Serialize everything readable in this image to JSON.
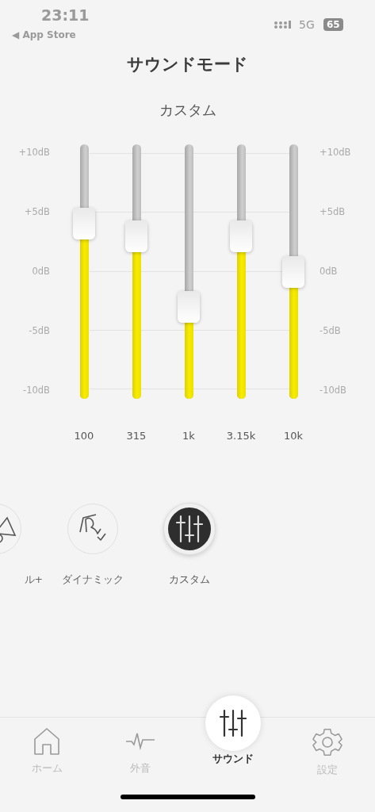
{
  "status_bar": {
    "time": "23:11",
    "back": "◀ App Store",
    "network": "5G",
    "battery": "65"
  },
  "title": "サウンドモード",
  "subtitle": "カスタム",
  "equalizer": {
    "scale_left": [
      "+10dB",
      "+5dB",
      "0dB",
      "-5dB",
      "-10dB"
    ],
    "scale_right": [
      "+10dB",
      "+5dB",
      "0dB",
      "-5dB",
      "-10dB"
    ],
    "bands": [
      {
        "label": "100",
        "level": 0.69
      },
      {
        "label": "315",
        "level": 0.64
      },
      {
        "label": "1k",
        "level": 0.36
      },
      {
        "label": "3.15k",
        "level": 0.64
      },
      {
        "label": "10k",
        "level": 0.5
      }
    ]
  },
  "modes": [
    {
      "label": "ル+",
      "kind": "partial",
      "selected": false
    },
    {
      "label": "ダイナミック",
      "kind": "dynamic",
      "selected": false
    },
    {
      "label": "カスタム",
      "kind": "custom",
      "selected": true
    }
  ],
  "tabs": [
    {
      "label": "ホーム",
      "kind": "home",
      "selected": false
    },
    {
      "label": "外音",
      "kind": "ambient",
      "selected": false
    },
    {
      "label": "サウンド",
      "kind": "sound",
      "selected": true
    },
    {
      "label": "設定",
      "kind": "settings",
      "selected": false
    }
  ]
}
